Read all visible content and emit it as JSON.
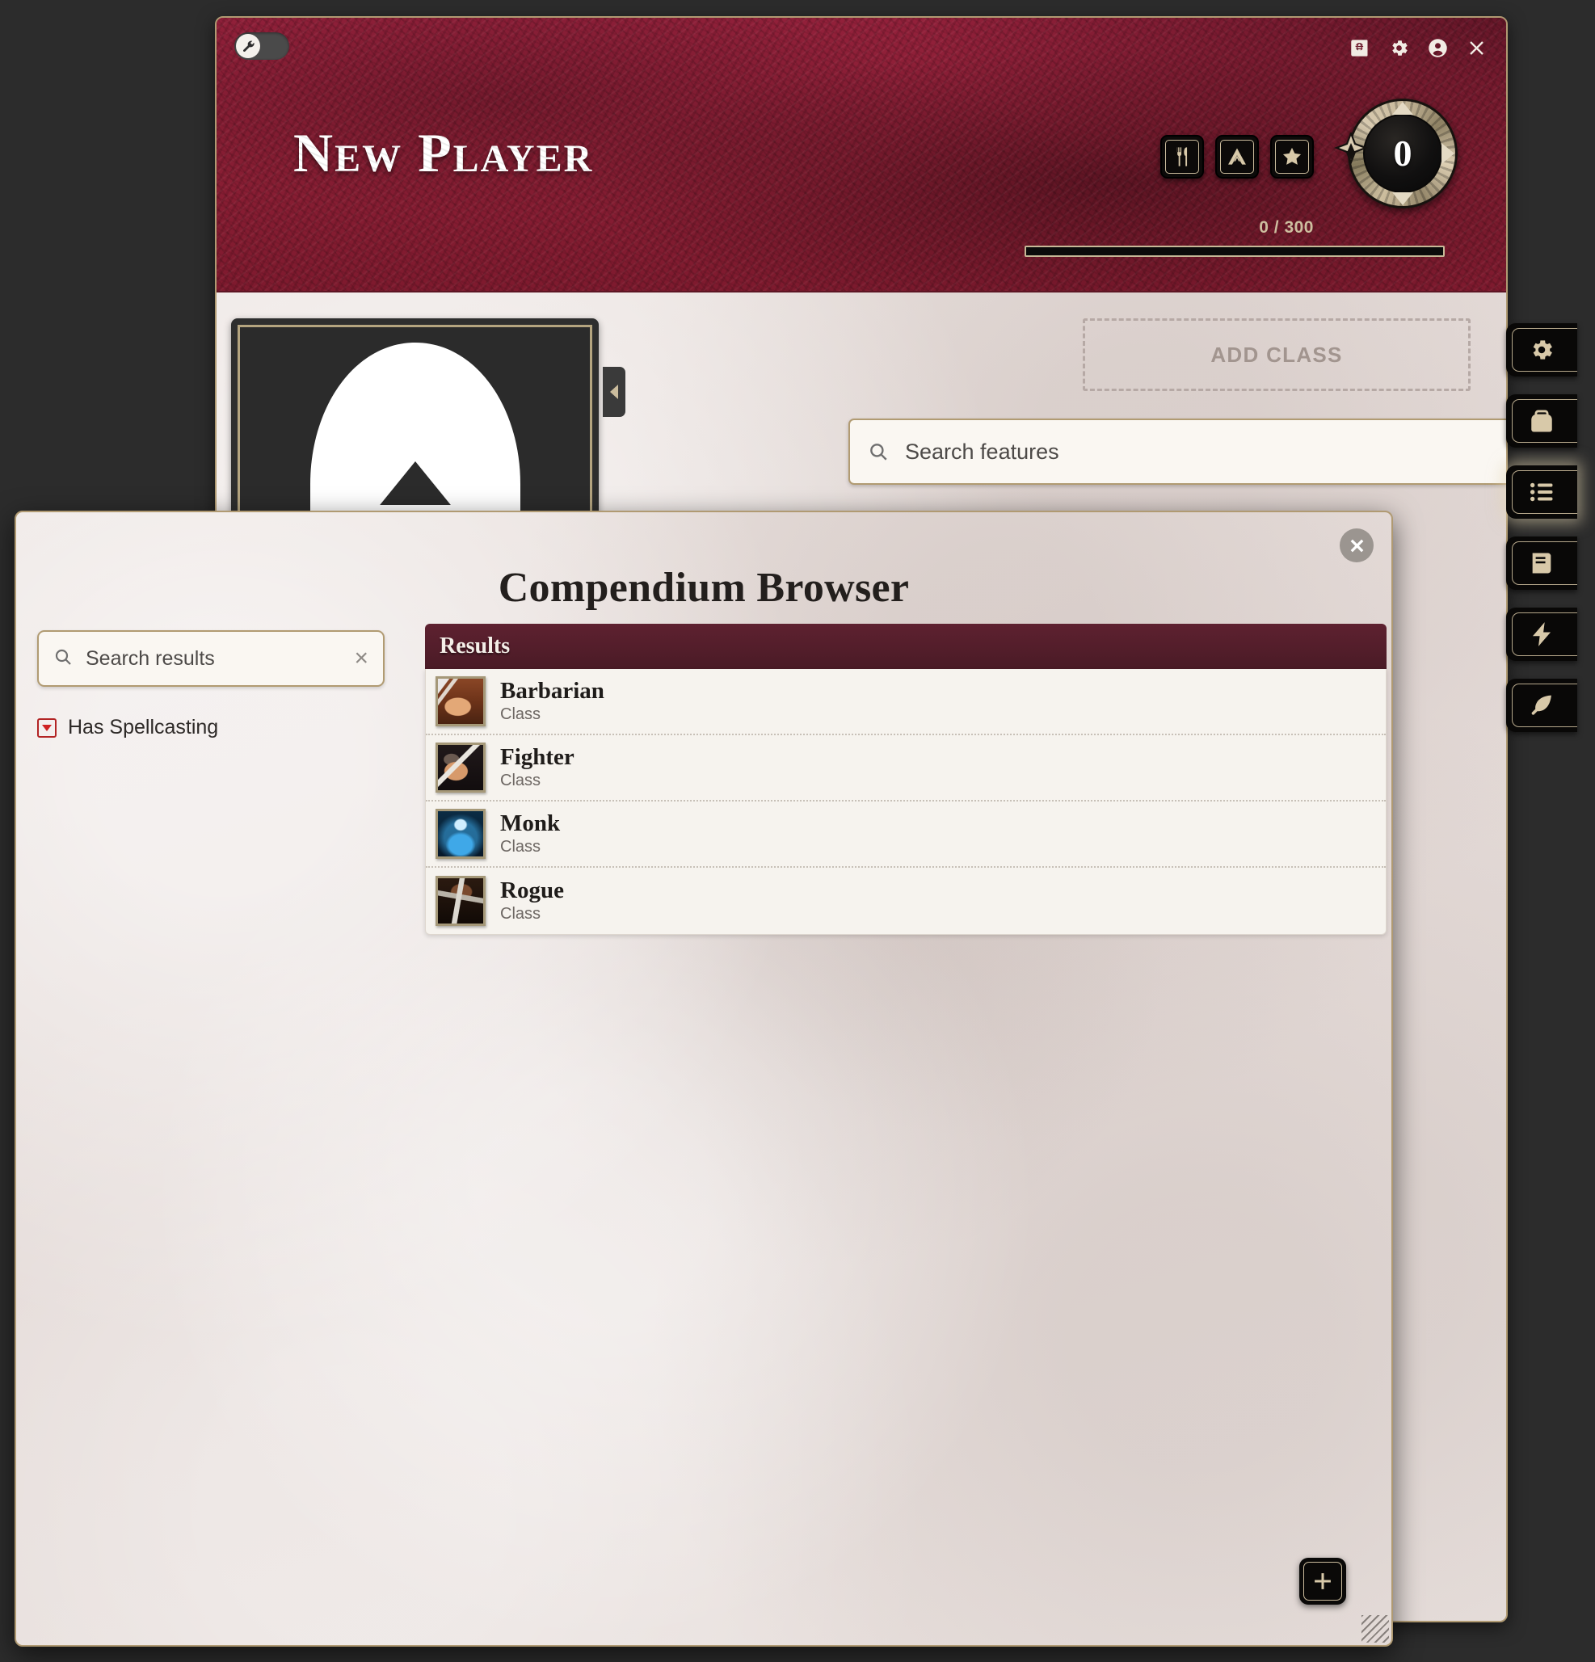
{
  "sheet": {
    "mode_toggle_icon": "wrench-icon",
    "actor_name": "New Player",
    "window_controls": [
      {
        "name": "compendium-icon",
        "label": "Compendium"
      },
      {
        "name": "gear-icon",
        "label": "Settings"
      },
      {
        "name": "user-icon",
        "label": "Player"
      },
      {
        "name": "close-icon",
        "label": "Close"
      }
    ],
    "header_actions": [
      {
        "name": "short-rest-icon",
        "label": "Short Rest"
      },
      {
        "name": "long-rest-icon",
        "label": "Long Rest"
      },
      {
        "name": "inspiration-icon",
        "label": "Inspiration"
      }
    ],
    "level": "0",
    "xp_text": "0 / 300",
    "xp_percent": 0,
    "portrait_icon": "hooded-figure-icon",
    "sidebar_collapse_icon": "chevron-left-icon",
    "add_class_label": "ADD CLASS",
    "features_search": {
      "placeholder": "Search features",
      "value": "",
      "clear_label": "×",
      "filter_icon": "funnel-icon",
      "sort_icon": "sort-descending-icon",
      "layers_icon": "layers-icon"
    }
  },
  "tool_rail": [
    {
      "name": "gear-icon",
      "label": "Settings",
      "active": false
    },
    {
      "name": "backpack-icon",
      "label": "Inventory",
      "active": false
    },
    {
      "name": "list-icon",
      "label": "Features",
      "active": true
    },
    {
      "name": "book-icon",
      "label": "Spellbook",
      "active": false
    },
    {
      "name": "bolt-icon",
      "label": "Actions",
      "active": false
    },
    {
      "name": "feather-icon",
      "label": "Effects",
      "active": false
    }
  ],
  "compendium": {
    "title": "Compendium Browser",
    "close_icon": "close-icon",
    "search": {
      "placeholder": "Search results",
      "value": "",
      "clear_label": "×"
    },
    "filters": [
      {
        "label": "Has Spellcasting",
        "icon": "collapse-caret-icon",
        "expanded": false
      }
    ],
    "results_header": "Results",
    "results": [
      {
        "name": "Barbarian",
        "type": "Class",
        "thumb": "barbarian-thumb"
      },
      {
        "name": "Fighter",
        "type": "Class",
        "thumb": "fighter-thumb"
      },
      {
        "name": "Monk",
        "type": "Class",
        "thumb": "monk-thumb"
      },
      {
        "name": "Rogue",
        "type": "Class",
        "thumb": "rogue-thumb"
      }
    ],
    "add_button_icon": "plus-icon"
  },
  "colors": {
    "banner_red": "#8a1e34",
    "gold_border": "#b09a72",
    "parchment": "#e7dedb",
    "results_header": "#4a1b26",
    "accent_tan": "#cdbe9f"
  }
}
